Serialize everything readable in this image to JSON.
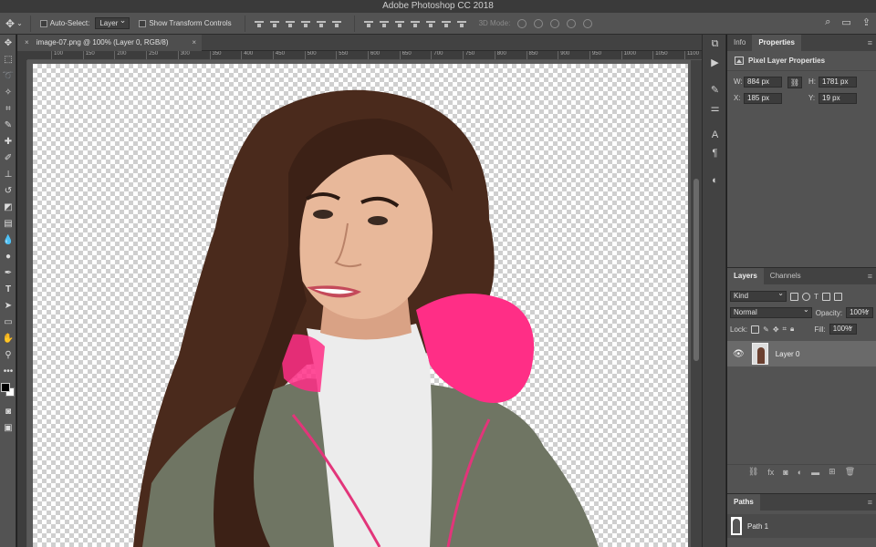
{
  "app": {
    "title": "Adobe Photoshop CC 2018"
  },
  "options_bar": {
    "auto_select_label": "Auto-Select:",
    "auto_select_value": "Layer",
    "show_transform_label": "Show Transform Controls",
    "mode_3d_label": "3D Mode:"
  },
  "document": {
    "tab_title": "image-07.png @ 100% (Layer 0, RGB/8)"
  },
  "ruler": {
    "ticks": [
      "100",
      "150",
      "200",
      "250",
      "300",
      "350",
      "400",
      "450",
      "500",
      "550",
      "600",
      "650",
      "700",
      "750",
      "800",
      "850",
      "900",
      "950",
      "1000",
      "1050",
      "1100",
      "1150"
    ]
  },
  "properties_panel": {
    "tabs": [
      "Info",
      "Properties"
    ],
    "active_tab": "Properties",
    "header": "Pixel Layer Properties",
    "w_label": "W:",
    "w_value": "884 px",
    "h_label": "H:",
    "h_value": "1781 px",
    "x_label": "X:",
    "x_value": "185 px",
    "y_label": "Y:",
    "y_value": "19 px"
  },
  "layers_panel": {
    "tabs": [
      "Layers",
      "Channels"
    ],
    "filter": "Kind",
    "blend_mode": "Normal",
    "opacity_label": "Opacity:",
    "opacity_value": "100%",
    "lock_label": "Lock:",
    "fill_label": "Fill:",
    "fill_value": "100%",
    "layers": [
      {
        "name": "Layer 0",
        "visible": true
      }
    ]
  },
  "paths_panel": {
    "tab": "Paths",
    "paths": [
      {
        "name": "Path 1"
      }
    ]
  },
  "colors": {
    "photo_bg": "#ffffff",
    "hair": "#4a2a1c",
    "jacket": "#6f7563",
    "fur": "#ff2e86",
    "sweater": "#ececec",
    "skin": "#e8b89a"
  }
}
